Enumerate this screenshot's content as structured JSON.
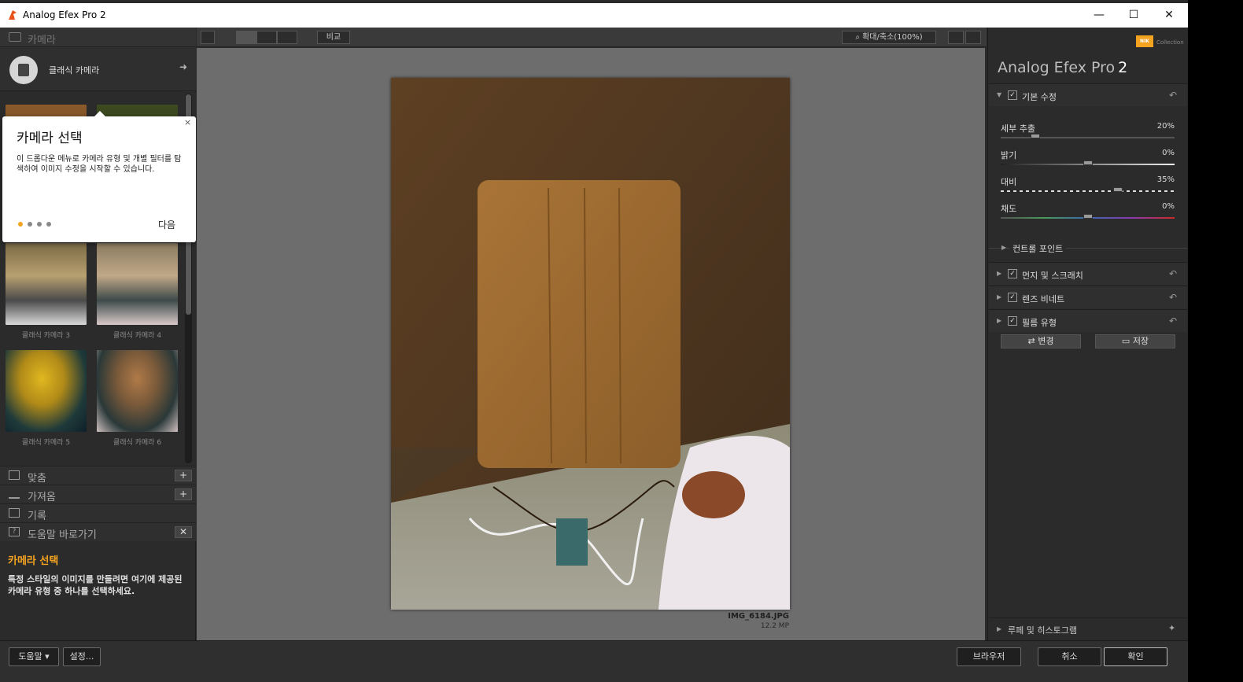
{
  "window": {
    "title": "Analog Efex Pro 2",
    "minimize": "—",
    "maximize": "☐",
    "close": "✕"
  },
  "left_panel": {
    "header": "카메라",
    "camera_type": "클래식 카메라",
    "camera_type_arrow": "➜",
    "thumbnails": [
      {
        "caption": "",
        "color": "#8a5a2a"
      },
      {
        "caption": "",
        "color": "#3d4a1f"
      },
      {
        "caption": "클래식 카메라 3",
        "color": "#7a6a45"
      },
      {
        "caption": "클래식 카메라 4",
        "color": "#8a7a60"
      },
      {
        "caption": "클래식 카메라 5",
        "color": "#b08a18"
      },
      {
        "caption": "클래식 카메라 6",
        "color": "#7a5a3a"
      }
    ],
    "sections": [
      {
        "label": "맞춤",
        "action": "+"
      },
      {
        "label": "가져옴",
        "action": "+"
      },
      {
        "label": "기록",
        "action": ""
      },
      {
        "label": "도움말 바로가기",
        "action": "✕"
      }
    ],
    "help_title": "카메라 선택",
    "help_body": "특정 스타일의 이미지를 만들려면 여기에 제공된 카메라 유형 중 하나를 선택하세요."
  },
  "popup": {
    "title": "카메라 선택",
    "body": "이 드롭다운 메뉴로 카메라 유형 및 개별 필터를 탐색하여 이미지 수정을 시작할 수 있습니다.",
    "close": "×",
    "next": "다음",
    "active_step": 1,
    "total_steps": 4
  },
  "toolbar": {
    "compare": "비교",
    "zoom": "확대/축소(100%)"
  },
  "image": {
    "filename": "IMG_6184.JPG",
    "size": "12.2 MP"
  },
  "right_panel": {
    "brand": "NIK",
    "brand_sub": "Collection",
    "product_name": "Analog Efex Pro",
    "product_version": "2",
    "basic_adjust": "기본 수정",
    "sliders": [
      {
        "label": "세부 추출",
        "value": "20%",
        "fraction": 0.2
      },
      {
        "label": "밝기",
        "value": "0%",
        "fraction": 0.5
      },
      {
        "label": "대비",
        "value": "35%",
        "fraction": 0.675
      },
      {
        "label": "채도",
        "value": "0%",
        "fraction": 0.5
      }
    ],
    "control_points": "컨트롤 포인트",
    "sections": [
      {
        "label": "먼지 및 스크래치",
        "checked": true
      },
      {
        "label": "렌즈 비네트",
        "checked": true
      },
      {
        "label": "필름 유형",
        "checked": true
      }
    ],
    "shuffle_label": "변경",
    "save_label": "저장",
    "loupe_histogram": "루페 및 히스토그램"
  },
  "bottom": {
    "help": "도움말 ▾",
    "settings": "설정...",
    "browse": "브라우저",
    "cancel": "취소",
    "ok": "확인"
  }
}
